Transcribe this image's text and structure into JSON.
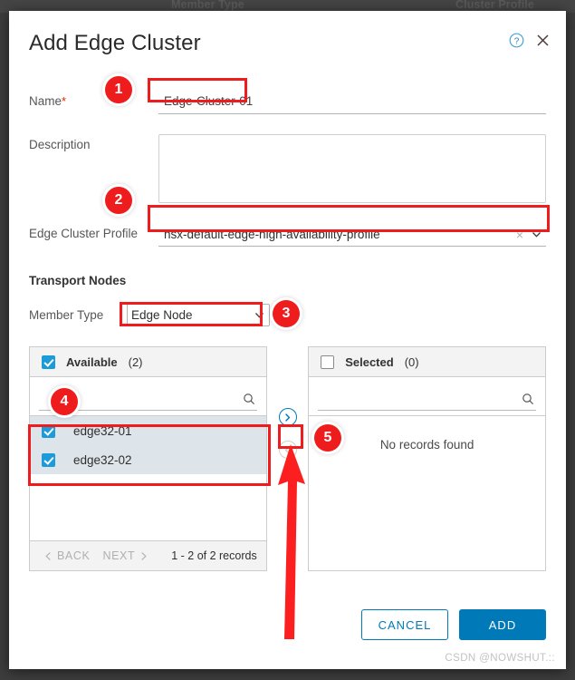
{
  "background": {
    "columns": [
      {
        "label": "Member Type"
      },
      {
        "label": "Cluster Profile"
      }
    ]
  },
  "modal": {
    "title": "Add Edge Cluster",
    "help_icon": "help-circle-icon",
    "close_icon": "close-icon",
    "fields": {
      "name": {
        "label": "Name",
        "required_marker": "*",
        "value": "Edge-Cluster-01",
        "placeholder": ""
      },
      "description": {
        "label": "Description",
        "value": "",
        "placeholder": ""
      },
      "edge_cluster_profile": {
        "label": "Edge Cluster Profile",
        "value": "nsx-default-edge-high-availability-profile",
        "clear_icon": "×",
        "caret_icon": "chevron-down-icon"
      }
    },
    "transport_nodes": {
      "heading": "Transport Nodes",
      "member_type": {
        "label": "Member Type",
        "value": "Edge Node",
        "caret_icon": "chevron-down-icon"
      },
      "available_panel": {
        "title": "Available",
        "count": "(2)",
        "header_checkbox": "checked",
        "search_placeholder": "",
        "search_value": "",
        "search_icon": "search-icon",
        "rows": [
          {
            "label": "edge32-01",
            "checked": true,
            "selected": true
          },
          {
            "label": "edge32-02",
            "checked": true,
            "selected": true
          }
        ],
        "footer": {
          "back_label": "BACK",
          "next_label": "NEXT",
          "records_label": "1 - 2 of 2 records"
        }
      },
      "selected_panel": {
        "title": "Selected",
        "count": "(0)",
        "header_checkbox": "unchecked",
        "search_placeholder": "",
        "search_value": "",
        "search_icon": "search-icon",
        "empty_message": "No records found",
        "rows": []
      },
      "transfer_buttons": {
        "move_right_icon": "chevron-right-circle-icon",
        "move_left_icon": "chevron-left-circle-icon"
      }
    },
    "footer": {
      "cancel_label": "CANCEL",
      "add_label": "ADD"
    }
  },
  "annotations": {
    "steps": [
      {
        "number": "1"
      },
      {
        "number": "2"
      },
      {
        "number": "3"
      },
      {
        "number": "4"
      },
      {
        "number": "5"
      }
    ],
    "color": "#ee1c1c"
  },
  "watermark": {
    "text": "CSDN @NOWSHUT.::"
  },
  "colors": {
    "accent": "#0079b8",
    "checkbox": "#1b9bd8",
    "annotation_red": "#ee1c1c",
    "required_red": "#e62700",
    "row_selected": "#dde4ea",
    "panel_header": "#f3f3f3"
  }
}
